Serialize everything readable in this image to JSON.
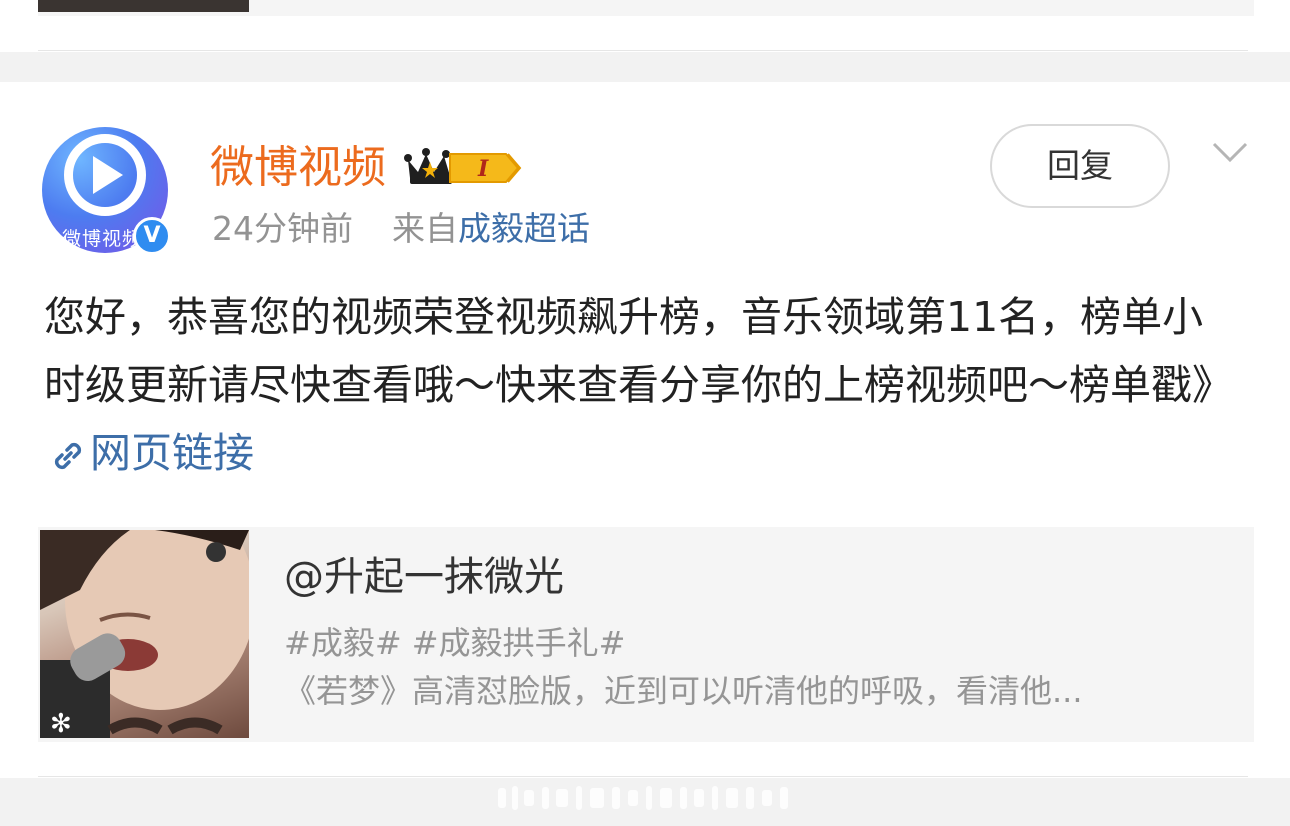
{
  "post": {
    "username": "微博视频",
    "member_level": "I",
    "avatar_text": "微博视频",
    "verified_mark": "V",
    "time_ago": "24分钟前",
    "source_prefix": "来自",
    "source_name": "成毅超话",
    "reply_label": "回复",
    "body_text": "您好，恭喜您的视频荣登视频飙升榜，音乐领域第11名，榜单小时级更新请尽快查看哦～快来查看分享你的上榜视频吧～榜单戳》",
    "link_text": "网页链接"
  },
  "embed": {
    "title": "@升起一抹微光",
    "tags": "#成毅# #成毅拱手礼#",
    "description": "《若梦》高清怼脸版，近到可以听清他的呼吸，看清他..."
  },
  "colors": {
    "username": "#ec6b1e",
    "link": "#3d6ea8",
    "meta_gray": "#939393",
    "body_text": "#222222",
    "verified_blue": "#2f8cf0",
    "card_bg": "#f5f5f5"
  }
}
